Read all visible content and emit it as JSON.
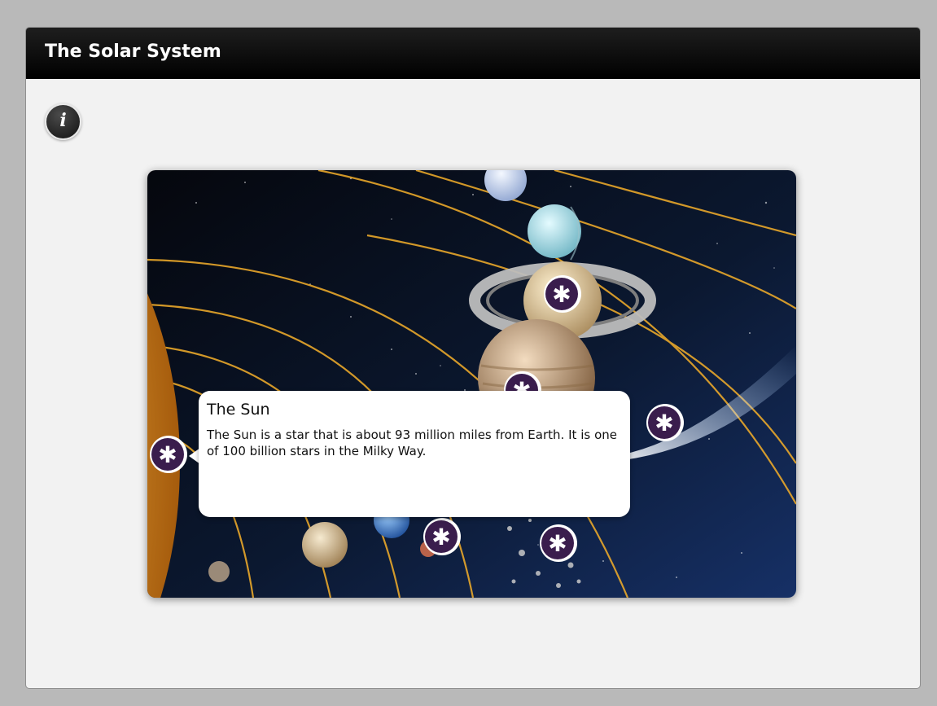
{
  "window": {
    "title": "The Solar System"
  },
  "info_button": {
    "glyph": "i",
    "icon": "info-icon"
  },
  "callout": {
    "title": "The Sun",
    "body": "The Sun is a star that is about 93 million miles from Earth. It is one of 100 billion stars in the Milky Way."
  },
  "hotspots": {
    "glyph": "✱",
    "icon": "asterisk-icon",
    "count": 7
  },
  "colors": {
    "titlebar": "#000000",
    "panel_background": "#f2f2f2",
    "hotspot_fill": "#3a1d4d",
    "orbit_lines": "#e8a72a",
    "space": "#0a1426"
  }
}
